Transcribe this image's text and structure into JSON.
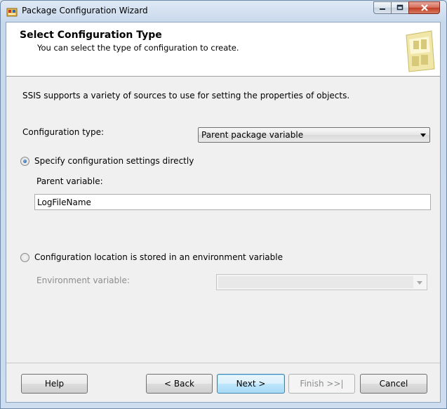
{
  "window": {
    "title": "Package Configuration Wizard"
  },
  "header": {
    "title": "Select Configuration Type",
    "subtitle": "You can select the type of configuration to create."
  },
  "intro_text": "SSIS supports a variety of sources to use for setting the properties of objects.",
  "configuration_type": {
    "label": "Configuration type:",
    "selected": "Parent package variable"
  },
  "option_direct": {
    "label": "Specify configuration settings directly",
    "checked": true
  },
  "parent_variable": {
    "label": "Parent variable:",
    "value": "LogFileName"
  },
  "option_env": {
    "label": "Configuration location is stored in an environment variable",
    "checked": false
  },
  "environment_variable": {
    "label": "Environment variable:",
    "value": ""
  },
  "buttons": {
    "help": "Help",
    "back": "< Back",
    "next": "Next >",
    "finish": "Finish >>|",
    "cancel": "Cancel"
  },
  "icons": {
    "app": "package-icon",
    "header_art": "wizard-graphic-icon",
    "minimize": "minimize-icon",
    "maximize": "maximize-icon",
    "close": "close-icon"
  }
}
